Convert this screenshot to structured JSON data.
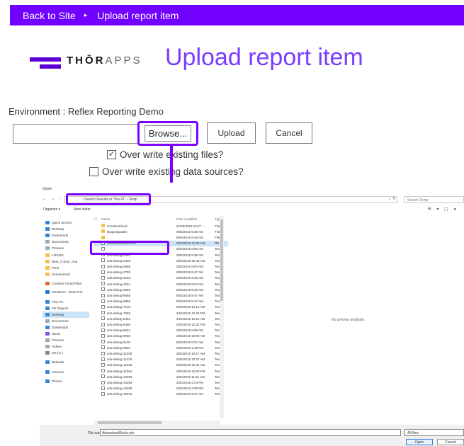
{
  "topbar": {
    "back_label": "Back to Site",
    "separator": "▸",
    "current": "Upload report item"
  },
  "brand": {
    "logo_bold": "THŌR",
    "logo_light": "APPS"
  },
  "page_title": "Upload report item",
  "form": {
    "environment_label": "Environment : Reflex Reporting Demo",
    "file_value": "",
    "browse_label": "Browse...",
    "upload_label": "Upload",
    "cancel_label": "Cancel",
    "overwrite_files_label": "Over write existing files?",
    "overwrite_files_checked": true,
    "overwrite_ds_label": "Over write existing data sources?",
    "overwrite_ds_checked": false
  },
  "dialog": {
    "title": "Open",
    "nav_arrows": "← → ↑",
    "address": "›  Search Results in This PC  ›  Temp",
    "search_placeholder": "Search Temp",
    "organize_label": "Organize ▾",
    "new_folder_label": "New folder",
    "nav_items": [
      "Quick access",
      "Desktop",
      "Downloads",
      "Documents",
      "Pictures",
      "LOGOS",
      "New_Colour_Ima",
      "PNG",
      "Screenshots",
      "Creative Cloud Files",
      "OneDrive - Bear Entr",
      "This PC",
      "3D Objects",
      "Desktop",
      "Documents",
      "Downloads",
      "Music",
      "Pictures",
      "Videos",
      "OS (C:)",
      "Network",
      "Camera",
      "Photos"
    ],
    "nav_selected": 13,
    "columns": {
      "name": "Name",
      "date": "Date modified",
      "type": "Typ"
    },
    "files": [
      {
        "name": "CreativeCloud",
        "date": "21/03/2019 12:07 ...",
        "type": "File",
        "kind": "folder"
      },
      {
        "name": "DiagOutputDir",
        "date": "8/04/2019 9:39 AM",
        "type": "File",
        "kind": "folder"
      },
      {
        "name": "",
        "date": "9/04/2019 8:46 AM",
        "type": "File",
        "kind": "folder"
      },
      {
        "name": "AdventureWorks.rdo",
        "date": "9/04/2019 12:29 AM",
        "type": "RD",
        "kind": "doc"
      },
      {
        "name": "",
        "date": "9/04/2019 8:55 AM",
        "type": "Tex",
        "kind": "doc"
      },
      {
        "name": "aria-debug-2364",
        "date": "3/04/2019 9:39 AM",
        "type": "Tex",
        "kind": "doc"
      },
      {
        "name": "aria-debug-2428",
        "date": "3/04/2019 10:46 AM",
        "type": "Tex",
        "kind": "doc"
      },
      {
        "name": "aria-debug-2688",
        "date": "3/04/2019 9:04 AM",
        "type": "Tex",
        "kind": "doc"
      },
      {
        "name": "aria-debug-2780",
        "date": "8/04/2019 8:47 AM",
        "type": "Tex",
        "kind": "doc"
      },
      {
        "name": "aria-debug-3248",
        "date": "9/04/2019 9:38 AM",
        "type": "Tex",
        "kind": "doc"
      },
      {
        "name": "aria-debug-3264",
        "date": "8/04/2019 9:04 AM",
        "type": "Tex",
        "kind": "doc"
      },
      {
        "name": "aria-debug-4088",
        "date": "8/04/2019 8:46 AM",
        "type": "Tex",
        "kind": "doc"
      },
      {
        "name": "aria-debug-6868",
        "date": "8/04/2019 8:47 AM",
        "type": "Tex",
        "kind": "doc"
      },
      {
        "name": "aria-debug-6956",
        "date": "8/04/2019 8:47 AM",
        "type": "Tex",
        "kind": "doc"
      },
      {
        "name": "aria-debug-7160",
        "date": "5/04/2019 10:12 AM",
        "type": "Tex",
        "kind": "doc"
      },
      {
        "name": "aria-debug-7696",
        "date": "3/04/2019 12:33 PM",
        "type": "Tex",
        "kind": "doc"
      },
      {
        "name": "aria-debug-8452",
        "date": "2/04/2019 10:12 AM",
        "type": "Tex",
        "kind": "doc"
      },
      {
        "name": "aria-debug-8480",
        "date": "2/04/2019 12:32 PM",
        "type": "Tex",
        "kind": "doc"
      },
      {
        "name": "aria-debug-8524",
        "date": "8/04/2019 8:59 AM",
        "type": "Tex",
        "kind": "doc"
      },
      {
        "name": "aria-debug-9056",
        "date": "3/04/2019 10:08 AM",
        "type": "Tex",
        "kind": "doc"
      },
      {
        "name": "aria-debug-9100",
        "date": "8/04/2019 8:57 AM",
        "type": "Tex",
        "kind": "doc"
      },
      {
        "name": "aria-debug-9804",
        "date": "2/04/2019 1:29 PM",
        "type": "Tex",
        "kind": "doc"
      },
      {
        "name": "aria-debug-11008",
        "date": "3/04/2019 10:17 AM",
        "type": "Tex",
        "kind": "doc"
      },
      {
        "name": "aria-debug-11320",
        "date": "5/04/2019 10:07 AM",
        "type": "Tex",
        "kind": "doc"
      },
      {
        "name": "aria-debug-11536",
        "date": "5/04/2019 10:31 AM",
        "type": "Tex",
        "kind": "doc"
      },
      {
        "name": "aria-debug-11664",
        "date": "2/04/2019 12:30 PM",
        "type": "Tex",
        "kind": "doc"
      },
      {
        "name": "aria-debug-12296",
        "date": "3/04/2019 11:51 AM",
        "type": "Tex",
        "kind": "doc"
      },
      {
        "name": "aria-debug-14284",
        "date": "2/04/2019 2:24 PM",
        "type": "Tex",
        "kind": "doc"
      },
      {
        "name": "aria-debug-14288",
        "date": "2/04/2019 2:09 PM",
        "type": "Tex",
        "kind": "doc"
      },
      {
        "name": "aria-debug-15076",
        "date": "9/04/2019 9:07 AM",
        "type": "Tex",
        "kind": "doc"
      }
    ],
    "selected_file": 3,
    "preview_text": "No preview available.",
    "file_name_label": "File name:",
    "file_name_value": "AdventureWorks.rdo",
    "filter_value": "All files",
    "open_label": "Open",
    "cancel_label": "Cancel"
  },
  "colors": {
    "accent": "#7b00ff",
    "topbar": "#7100ff",
    "title": "#7a3cff",
    "selection": "#cce4f7"
  }
}
